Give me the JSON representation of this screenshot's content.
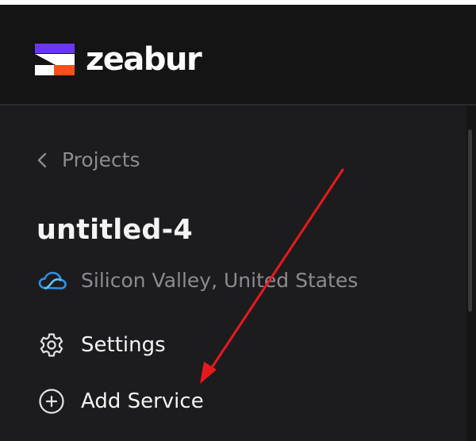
{
  "header": {
    "brand_name": "zeabur",
    "logo_icon": "zeabur-logo-icon",
    "colors": {
      "logo_purple": "#6b35f5",
      "logo_orange": "#ff4e1a",
      "logo_white": "#ffffff"
    }
  },
  "sidebar": {
    "back_link": {
      "icon": "chevron-left-icon",
      "label": "Projects"
    },
    "project": {
      "name": "untitled-4",
      "region": {
        "icon": "cloud-icon",
        "label": "Silicon Valley, United States",
        "icon_color": "#2f8fe8"
      }
    },
    "items": [
      {
        "icon": "gear-icon",
        "label": "Settings"
      },
      {
        "icon": "plus-circle-icon",
        "label": "Add Service"
      }
    ]
  },
  "annotation": {
    "type": "arrow",
    "color": "#e8191d"
  }
}
